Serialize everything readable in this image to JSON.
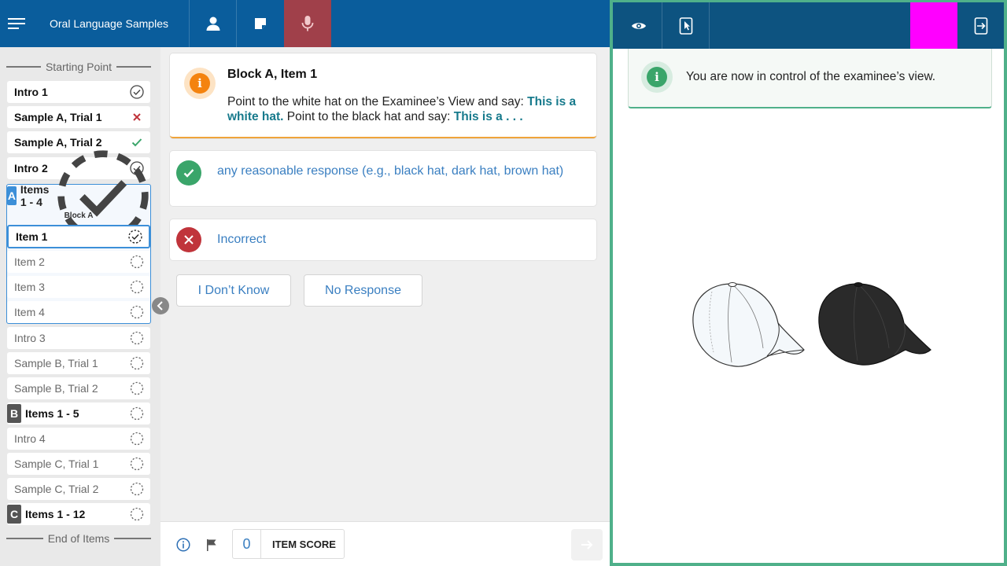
{
  "app": {
    "title": "Oral Language Samples",
    "accent": "#0a5d9c",
    "active_tab_color": "#a0404a"
  },
  "toolbar": {
    "menu_icon": "hamburger-menu-icon",
    "buttons": [
      {
        "icon": "person-icon"
      },
      {
        "icon": "note-icon"
      },
      {
        "icon": "microphone-icon",
        "active": true
      }
    ]
  },
  "sidebar": {
    "start_label": "Starting Point",
    "end_label": "End of Items",
    "items": [
      {
        "label": "Intro 1",
        "status": "complete"
      },
      {
        "label": "Sample A, Trial 1",
        "status": "incorrect"
      },
      {
        "label": "Sample A, Trial 2",
        "status": "correct"
      },
      {
        "label": "Intro 2",
        "status": "complete"
      }
    ],
    "block_a": {
      "letter": "A",
      "label": "Items 1 - 4",
      "sublabel": "Block A",
      "items": [
        {
          "label": "Item 1",
          "status": "in-progress",
          "selected": true
        },
        {
          "label": "Item 2",
          "status": "pending"
        },
        {
          "label": "Item 3",
          "status": "pending"
        },
        {
          "label": "Item 4",
          "status": "pending"
        }
      ]
    },
    "after_a": [
      {
        "label": "Intro 3",
        "status": "pending"
      },
      {
        "label": "Sample B, Trial 1",
        "status": "pending"
      },
      {
        "label": "Sample B, Trial 2",
        "status": "pending"
      }
    ],
    "block_b": {
      "letter": "B",
      "label": "Items 1 - 5"
    },
    "after_b": [
      {
        "label": "Intro 4",
        "status": "pending"
      },
      {
        "label": "Sample C, Trial 1",
        "status": "pending"
      },
      {
        "label": "Sample C, Trial 2",
        "status": "pending"
      }
    ],
    "block_c": {
      "letter": "C",
      "label": "Items 1 - 12"
    }
  },
  "item": {
    "title": "Block A, Item 1",
    "instruction_part1": "Point to the white hat on the Examinee’s View and say: ",
    "instruction_bold1": "This is a white hat.",
    "instruction_part2": " Point to the black hat and say: ",
    "instruction_bold2": "This is a . . ."
  },
  "responses": {
    "correct_text": "any reasonable response (e.g., black hat, dark hat, brown hat)",
    "incorrect_text": "Incorrect"
  },
  "buttons": {
    "dont_know": "I Don’t Know",
    "no_response": "No Response"
  },
  "footer": {
    "score": "0",
    "score_label": "ITEM SCORE"
  },
  "examinee": {
    "banner_text": "You are now in control of the examinee’s view.",
    "frame_color": "#4fb08a",
    "highlight_color": "#ff00ff",
    "images": [
      "white baseball cap",
      "black baseball cap"
    ]
  }
}
